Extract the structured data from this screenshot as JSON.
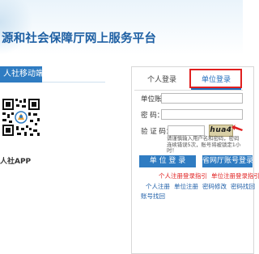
{
  "header": {
    "site_title": "源和社会保障厅网上服务平台"
  },
  "mobile": {
    "tab_label": "人社移动端",
    "app_label": "人社APP"
  },
  "login": {
    "tabs": [
      {
        "label": "个人登录",
        "active": false
      },
      {
        "label": "单位登录",
        "active": true
      }
    ],
    "fields": {
      "account_label": "单位账号：",
      "password_label": "密    码：",
      "captcha_label": "验 证 码："
    },
    "captcha_text": "hua4",
    "hint": "请谨慎输入用户名和密码，密码连续错误5次，账号将被锁定1小时！",
    "login_button": "单 位 登 录",
    "electronic_button": "省网厅账号登录",
    "red_links": [
      "个人注册登录指引",
      "单位注册登录指引"
    ],
    "blue_links": [
      "个人注册",
      "单位注册",
      "密码修改",
      "密码找回"
    ],
    "recover_link": "账号找回"
  },
  "colors": {
    "brand_blue": "#2f7cc2",
    "title_blue": "#1d5fa3",
    "highlight_red": "#e02020"
  }
}
